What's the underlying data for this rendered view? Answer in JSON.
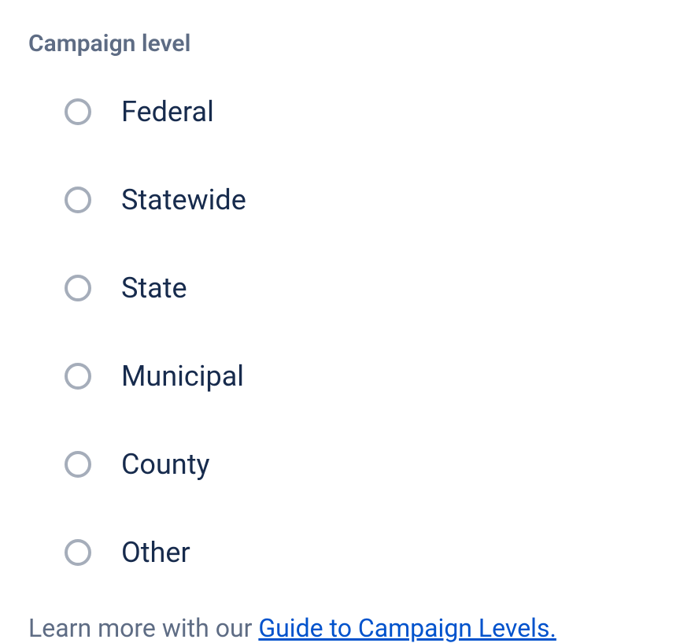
{
  "section": {
    "title": "Campaign level"
  },
  "options": [
    {
      "label": "Federal"
    },
    {
      "label": "Statewide"
    },
    {
      "label": "State"
    },
    {
      "label": "Municipal"
    },
    {
      "label": "County"
    },
    {
      "label": "Other"
    }
  ],
  "help": {
    "prefix": "Learn more with our ",
    "link_text": "Guide to Campaign Levels."
  }
}
